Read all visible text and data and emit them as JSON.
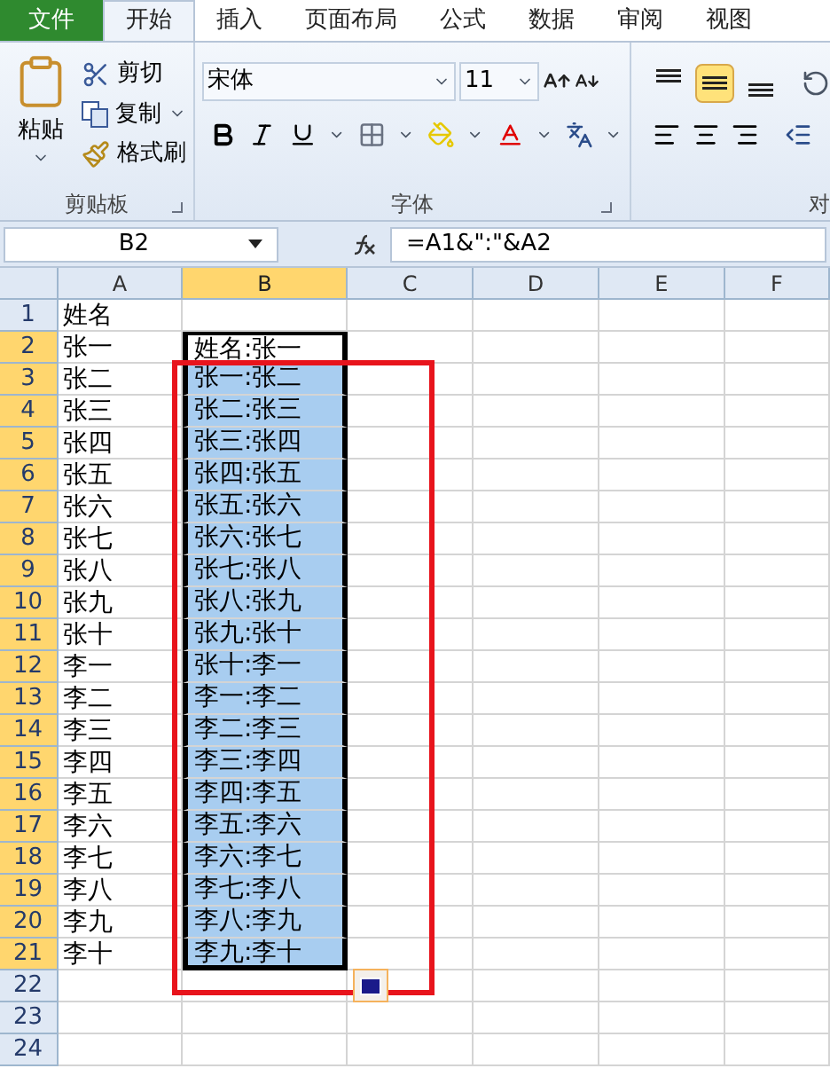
{
  "tabs": [
    {
      "label": "文件",
      "kind": "file",
      "selected": false
    },
    {
      "label": "开始",
      "kind": "tab",
      "selected": true
    },
    {
      "label": "插入",
      "kind": "tab",
      "selected": false
    },
    {
      "label": "页面布局",
      "kind": "tab",
      "selected": false
    },
    {
      "label": "公式",
      "kind": "tab",
      "selected": false
    },
    {
      "label": "数据",
      "kind": "tab",
      "selected": false
    },
    {
      "label": "审阅",
      "kind": "tab",
      "selected": false
    },
    {
      "label": "视图",
      "kind": "tab",
      "selected": false
    }
  ],
  "clipboard": {
    "paste": "粘贴",
    "cut": "剪切",
    "copy": "复制",
    "format_painter": "格式刷",
    "group_label": "剪贴板"
  },
  "font": {
    "name": "宋体",
    "size": "11",
    "group_label": "字体"
  },
  "alignment": {
    "vertical": [
      {
        "selected": false
      },
      {
        "selected": true
      },
      {
        "selected": false
      }
    ],
    "group_label": "对"
  },
  "name_box": "B2",
  "formula": "=A1&\":\"&A2",
  "columns": [
    {
      "label": "A",
      "selected": false
    },
    {
      "label": "B",
      "selected": true
    },
    {
      "label": "C",
      "selected": false
    },
    {
      "label": "D",
      "selected": false
    },
    {
      "label": "E",
      "selected": false
    },
    {
      "label": "F",
      "selected": false
    }
  ],
  "rows": [
    {
      "number": "1",
      "selected": false,
      "a": "姓名",
      "b": "",
      "in_selection": false,
      "highlighted": false
    },
    {
      "number": "2",
      "selected": true,
      "a": "张一",
      "b": "姓名:张一",
      "in_selection": true,
      "highlighted": false
    },
    {
      "number": "3",
      "selected": true,
      "a": "张二",
      "b": "张一:张二",
      "in_selection": true,
      "highlighted": true
    },
    {
      "number": "4",
      "selected": true,
      "a": "张三",
      "b": "张二:张三",
      "in_selection": true,
      "highlighted": true
    },
    {
      "number": "5",
      "selected": true,
      "a": "张四",
      "b": "张三:张四",
      "in_selection": true,
      "highlighted": true
    },
    {
      "number": "6",
      "selected": true,
      "a": "张五",
      "b": "张四:张五",
      "in_selection": true,
      "highlighted": true
    },
    {
      "number": "7",
      "selected": true,
      "a": "张六",
      "b": "张五:张六",
      "in_selection": true,
      "highlighted": true
    },
    {
      "number": "8",
      "selected": true,
      "a": "张七",
      "b": "张六:张七",
      "in_selection": true,
      "highlighted": true
    },
    {
      "number": "9",
      "selected": true,
      "a": "张八",
      "b": "张七:张八",
      "in_selection": true,
      "highlighted": true
    },
    {
      "number": "10",
      "selected": true,
      "a": "张九",
      "b": "张八:张九",
      "in_selection": true,
      "highlighted": true
    },
    {
      "number": "11",
      "selected": true,
      "a": "张十",
      "b": "张九:张十",
      "in_selection": true,
      "highlighted": true
    },
    {
      "number": "12",
      "selected": true,
      "a": "李一",
      "b": "张十:李一",
      "in_selection": true,
      "highlighted": true
    },
    {
      "number": "13",
      "selected": true,
      "a": "李二",
      "b": "李一:李二",
      "in_selection": true,
      "highlighted": true
    },
    {
      "number": "14",
      "selected": true,
      "a": "李三",
      "b": "李二:李三",
      "in_selection": true,
      "highlighted": true
    },
    {
      "number": "15",
      "selected": true,
      "a": "李四",
      "b": "李三:李四",
      "in_selection": true,
      "highlighted": true
    },
    {
      "number": "16",
      "selected": true,
      "a": "李五",
      "b": "李四:李五",
      "in_selection": true,
      "highlighted": true
    },
    {
      "number": "17",
      "selected": true,
      "a": "李六",
      "b": "李五:李六",
      "in_selection": true,
      "highlighted": true
    },
    {
      "number": "18",
      "selected": true,
      "a": "李七",
      "b": "李六:李七",
      "in_selection": true,
      "highlighted": true
    },
    {
      "number": "19",
      "selected": true,
      "a": "李八",
      "b": "李七:李八",
      "in_selection": true,
      "highlighted": true
    },
    {
      "number": "20",
      "selected": true,
      "a": "李九",
      "b": "李八:李九",
      "in_selection": true,
      "highlighted": true
    },
    {
      "number": "21",
      "selected": true,
      "a": "李十",
      "b": "李九:李十",
      "in_selection": true,
      "highlighted": true
    },
    {
      "number": "22",
      "selected": false,
      "a": "",
      "b": "",
      "in_selection": false,
      "highlighted": false
    },
    {
      "number": "23",
      "selected": false,
      "a": "",
      "b": "",
      "in_selection": false,
      "highlighted": false
    },
    {
      "number": "24",
      "selected": false,
      "a": "",
      "b": "",
      "in_selection": false,
      "highlighted": false
    }
  ]
}
